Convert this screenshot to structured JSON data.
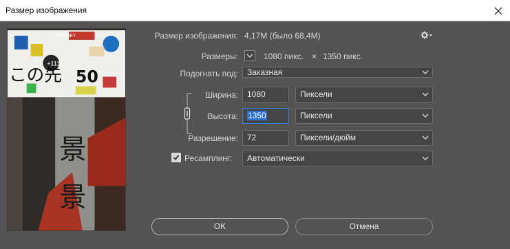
{
  "window": {
    "title": "Размер изображения"
  },
  "image_size": {
    "label": "Размер изображения:",
    "value": "4,17M (было 68,4M)"
  },
  "dimensions": {
    "label": "Размеры:",
    "width": "1080 пикс.",
    "sep": "×",
    "height": "1350 пикс."
  },
  "fit_to": {
    "label": "Подогнать под:",
    "value": "Заказная"
  },
  "width": {
    "label": "Ширина:",
    "value": "1080",
    "unit": "Пиксели"
  },
  "height": {
    "label": "Высота:",
    "value": "1350",
    "unit": "Пиксели"
  },
  "resolution": {
    "label": "Разрешение:",
    "value": "72",
    "unit": "Пиксели/дюйм"
  },
  "resample": {
    "label": "Ресамплинг:",
    "checked": true,
    "value": "Автоматически"
  },
  "buttons": {
    "ok": "OK",
    "cancel": "Отмена"
  },
  "preview": {
    "sign_main": "この先",
    "sign_number": "50",
    "sticker_number": "+111°",
    "sticker_red": "ПРИВЕТ",
    "pole_chars": "景"
  },
  "colors": {
    "dialog_bg": "#535353",
    "field_bg": "#454545",
    "focus": "#3d7fd6",
    "selection": "#2f6fd0"
  }
}
